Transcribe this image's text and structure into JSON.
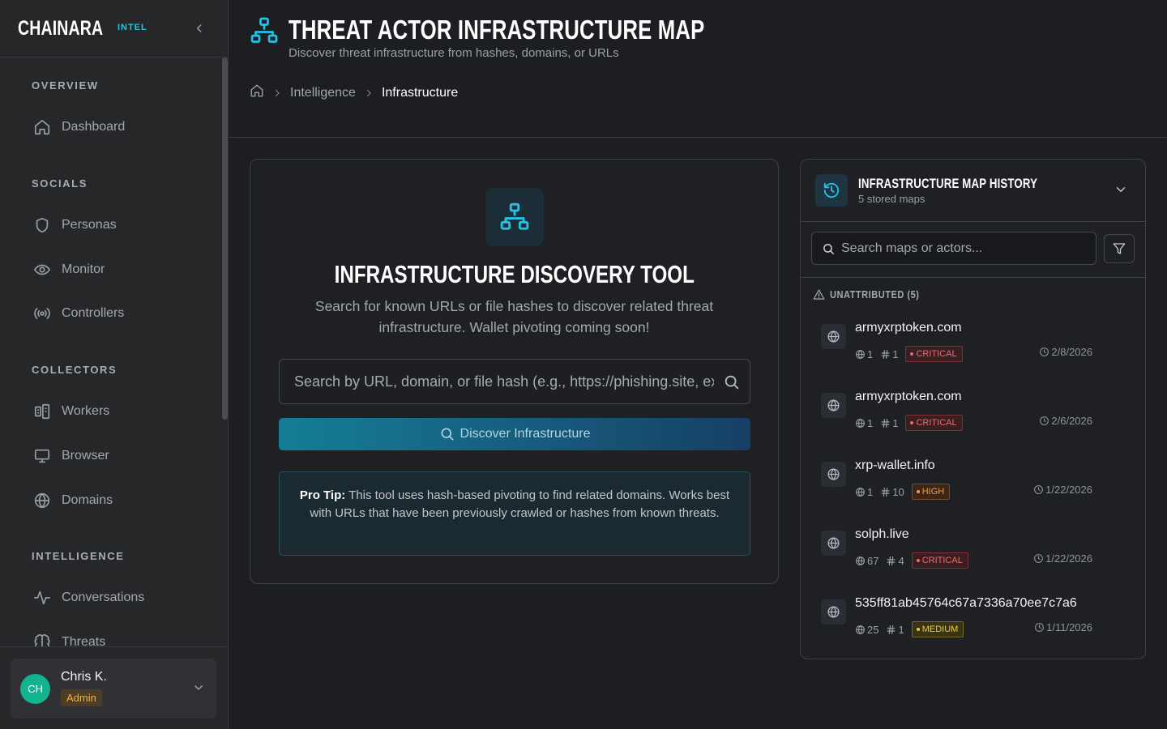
{
  "brand": {
    "name": "CHAINARA",
    "tag": "INTEL"
  },
  "sidebar": {
    "sections": [
      {
        "label": "OVERVIEW"
      },
      {
        "label": "SOCIALS"
      },
      {
        "label": "COLLECTORS"
      },
      {
        "label": "INTELLIGENCE"
      }
    ],
    "items": [
      {
        "label": "Dashboard",
        "icon": "home-icon"
      },
      {
        "label": "Personas",
        "icon": "shield-icon"
      },
      {
        "label": "Monitor",
        "icon": "eye-icon"
      },
      {
        "label": "Controllers",
        "icon": "broadcast-icon"
      },
      {
        "label": "Workers",
        "icon": "workers-icon"
      },
      {
        "label": "Browser",
        "icon": "monitor-icon"
      },
      {
        "label": "Domains",
        "icon": "globe-icon"
      },
      {
        "label": "Conversations",
        "icon": "activity-icon"
      },
      {
        "label": "Threats",
        "icon": "brain-icon"
      }
    ]
  },
  "user": {
    "initials": "CH",
    "name": "Chris K.",
    "role": "Admin"
  },
  "header": {
    "title": "THREAT ACTOR INFRASTRUCTURE MAP",
    "subtitle": "Discover threat infrastructure from hashes, domains, or URLs",
    "breadcrumb": [
      "Intelligence",
      "Infrastructure"
    ]
  },
  "tool": {
    "title": "INFRASTRUCTURE DISCOVERY TOOL",
    "description": "Search for known URLs or file hashes to discover related threat infrastructure. Wallet pivoting coming soon!",
    "search_placeholder": "Search by URL, domain, or file hash (e.g., https://phishing.site, example.com)",
    "button_label": "Discover Infrastructure",
    "tip_label": "Pro Tip:",
    "tip_text": " This tool uses hash-based pivoting to find related domains. Works best with URLs that have been previously crawled or hashes from known threats."
  },
  "history": {
    "title": "INFRASTRUCTURE MAP HISTORY",
    "count": "5 stored maps",
    "search_placeholder": "Search maps or actors...",
    "group_label": "UNATTRIBUTED (5)",
    "entries": [
      {
        "name": "armyxrptoken.com",
        "domains": "1",
        "hashes": "1",
        "severity": "CRITICAL",
        "date": "2/8/2026"
      },
      {
        "name": "armyxrptoken.com",
        "domains": "1",
        "hashes": "1",
        "severity": "CRITICAL",
        "date": "2/6/2026"
      },
      {
        "name": "xrp-wallet.info",
        "domains": "1",
        "hashes": "10",
        "severity": "HIGH",
        "date": "1/22/2026"
      },
      {
        "name": "solph.live",
        "domains": "67",
        "hashes": "4",
        "severity": "CRITICAL",
        "date": "1/22/2026"
      },
      {
        "name": "535ff81ab45764c67a7336a70ee7c7a6",
        "domains": "25",
        "hashes": "1",
        "severity": "MEDIUM",
        "date": "1/11/2026"
      }
    ]
  },
  "colors": {
    "accent": "#22c3e6",
    "critical": "#f06a6a",
    "high": "#f59a48",
    "medium": "#e9cc3c",
    "avatar": "#12b38e"
  }
}
